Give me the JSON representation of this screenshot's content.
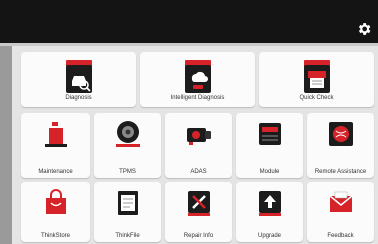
{
  "toolbar": {
    "settings_icon": "gear-icon"
  },
  "tiles": {
    "diagnosis": {
      "label": "Diagnosis",
      "icon": "car-search-icon"
    },
    "intelligent": {
      "label": "Intelligent Diagnosis",
      "icon": "cloud-car-icon"
    },
    "quick": {
      "label": "Quick Check",
      "icon": "printer-check-icon"
    },
    "maintenance": {
      "label": "Maintenance",
      "icon": "oil-can-icon"
    },
    "tpms": {
      "label": "TPMS",
      "icon": "tire-icon"
    },
    "adas": {
      "label": "ADAS",
      "icon": "camera-icon"
    },
    "module": {
      "label": "Module",
      "icon": "module-icon"
    },
    "remote": {
      "label": "Remote Assistance",
      "icon": "remote-globe-icon"
    },
    "thinkstore": {
      "label": "ThinkStore",
      "icon": "shopping-bag-icon"
    },
    "thinkfile": {
      "label": "ThinkFile",
      "icon": "file-icon"
    },
    "repair": {
      "label": "Repair Info",
      "icon": "tools-icon"
    },
    "upgrade": {
      "label": "Upgrade",
      "icon": "upload-icon"
    },
    "feedback": {
      "label": "Feedback",
      "icon": "mail-icon"
    }
  },
  "colors": {
    "accent": "#d6232a",
    "dark": "#1c1c1c",
    "topbar": "#141414"
  }
}
